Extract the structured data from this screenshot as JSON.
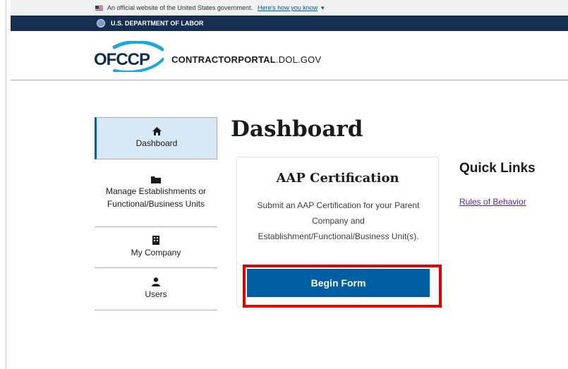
{
  "gov_banner": {
    "text": "An official website of the United States government.",
    "link": "Here's how you know",
    "caret_icon": "chevron-down-icon"
  },
  "agency_bar": {
    "name": "U.S. DEPARTMENT OF LABOR"
  },
  "header": {
    "logo_text": "OFCCP",
    "site_name_bold": "CONTRACTORPORTAL",
    "site_name_suffix": ".DOL.GOV"
  },
  "sidebar": {
    "items": [
      {
        "label": "Dashboard",
        "icon": "home-icon",
        "active": true
      },
      {
        "label": "Manage Establishments or Functional/Business Units",
        "icon": "folder-icon",
        "active": false
      },
      {
        "label": "My Company",
        "icon": "building-icon",
        "active": false
      },
      {
        "label": "Users",
        "icon": "user-icon",
        "active": false
      }
    ]
  },
  "main": {
    "title": "Dashboard",
    "card": {
      "title": "AAP Certification",
      "text": "Submit an AAP Certification for your Parent Company and Establishment/Functional/Business Unit(s).",
      "button_label": "Begin Form"
    }
  },
  "quick_links": {
    "title": "Quick Links",
    "links": [
      "Rules of Behavior"
    ]
  },
  "colors": {
    "navy": "#162e51",
    "primary_blue": "#005ea2",
    "active_nav_bg": "#d9e8f6",
    "highlight_red": "#e00000",
    "visited_link": "#54278f"
  }
}
